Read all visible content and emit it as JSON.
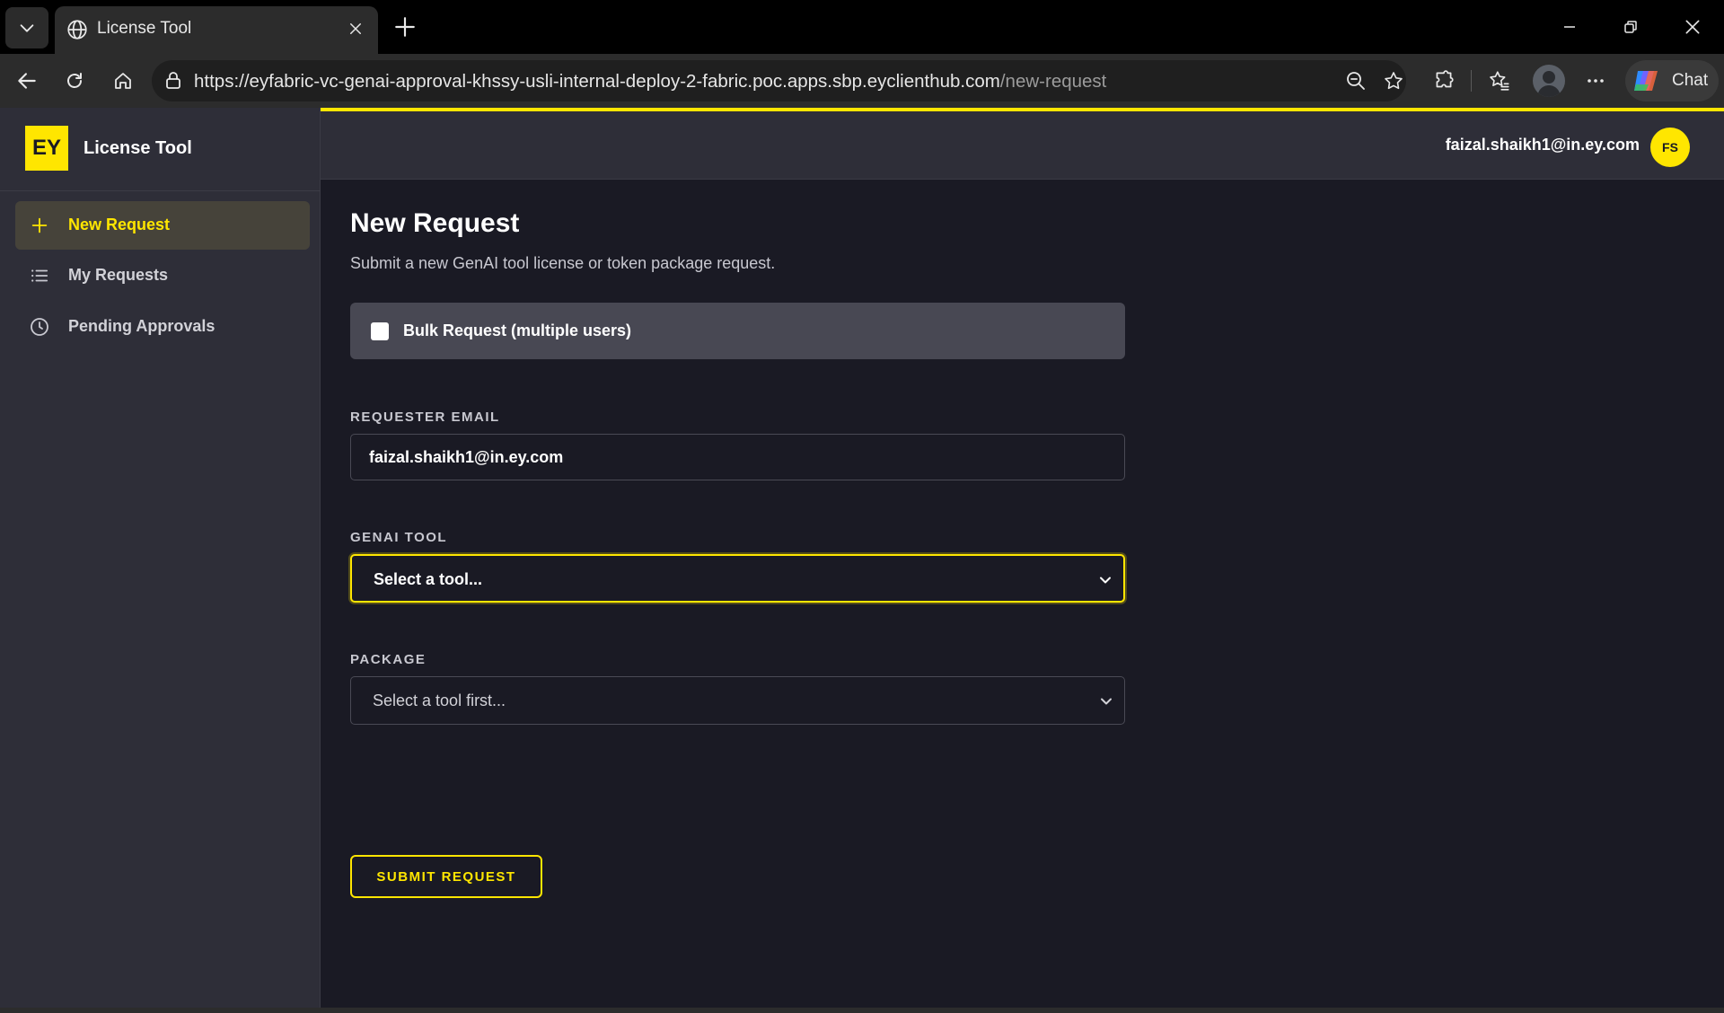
{
  "browser": {
    "tab_title": "License Tool",
    "url_main": "https://eyfabric-vc-genai-approval-khssy-usli-internal-deploy-2-fabric.poc.apps.sbp.eyclienthub.com",
    "url_path": "/new-request",
    "chat_label": "Chat"
  },
  "app": {
    "logo_text": "EY",
    "name": "License Tool",
    "brand_color": "#ffe600"
  },
  "sidebar": {
    "items": [
      {
        "label": "New Request",
        "icon": "plus-icon",
        "active": true
      },
      {
        "label": "My Requests",
        "icon": "list-icon",
        "active": false
      },
      {
        "label": "Pending Approvals",
        "icon": "clock-icon",
        "active": false
      }
    ]
  },
  "header": {
    "user_email": "faizal.shaikh1@in.ey.com",
    "avatar_initials": "FS"
  },
  "main": {
    "title": "New Request",
    "subtitle": "Submit a new GenAI tool license or token package request.",
    "bulk_label": "Bulk Request (multiple users)",
    "bulk_checked": false,
    "requester_label": "REQUESTER EMAIL",
    "requester_value": "faizal.shaikh1@in.ey.com",
    "tool_label": "GENAI TOOL",
    "tool_value": "Select a tool...",
    "package_label": "PACKAGE",
    "package_value": "Select a tool first...",
    "submit_label": "SUBMIT REQUEST"
  }
}
